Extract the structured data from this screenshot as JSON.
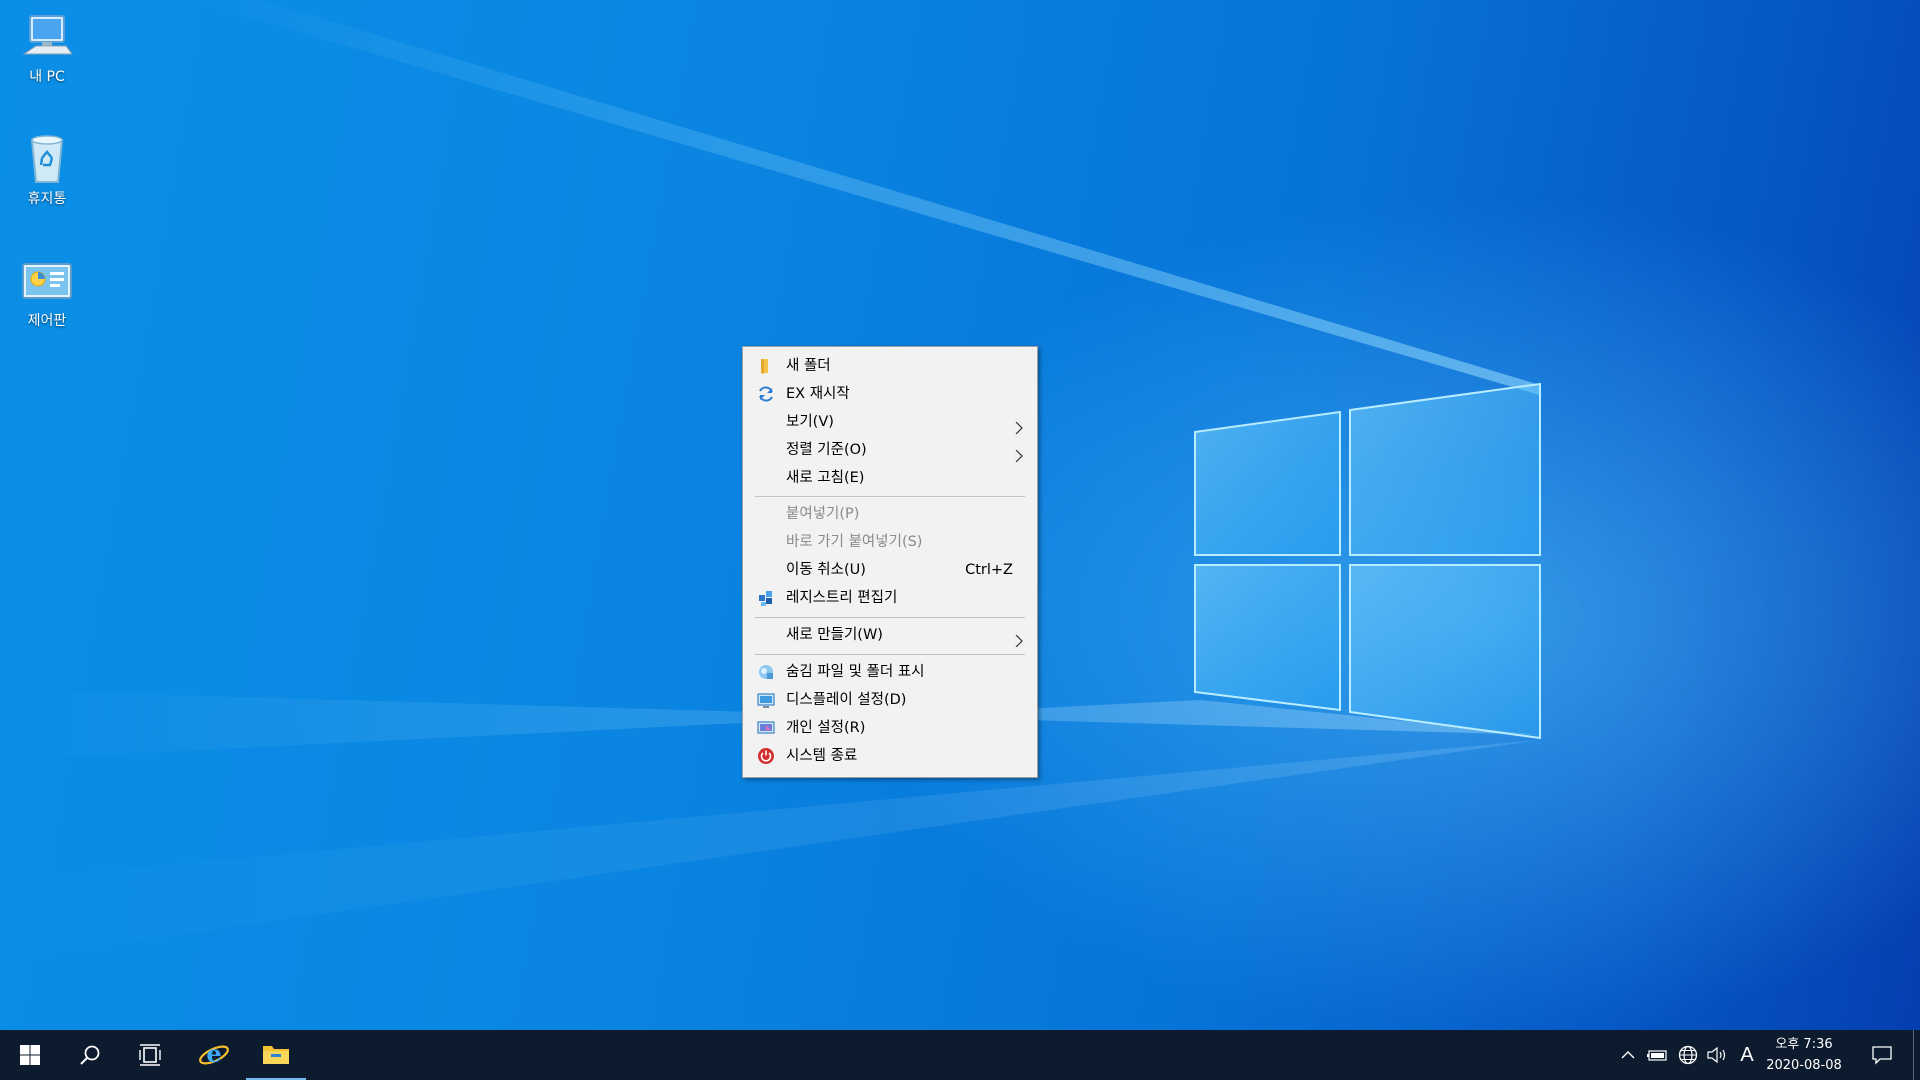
{
  "desktop_icons": [
    {
      "label": "내 PC",
      "icon": "computer-icon"
    },
    {
      "label": "휴지통",
      "icon": "recycle-bin-icon"
    },
    {
      "label": "제어판",
      "icon": "control-panel-icon"
    }
  ],
  "context_menu": {
    "items": [
      {
        "label": "새 폴더",
        "icon": "folder-icon",
        "enabled": true
      },
      {
        "label": "EX 재시작",
        "icon": "refresh-icon",
        "enabled": true
      },
      {
        "label": "보기(V)",
        "submenu": true,
        "enabled": true
      },
      {
        "label": "정렬 기준(O)",
        "submenu": true,
        "enabled": true
      },
      {
        "label": "새로 고침(E)",
        "enabled": true
      },
      {
        "label": "붙여넣기(P)",
        "enabled": false
      },
      {
        "label": "바로 가기 붙여넣기(S)",
        "enabled": false
      },
      {
        "label": "이동 취소(U)",
        "shortcut": "Ctrl+Z",
        "enabled": true
      },
      {
        "label": "레지스트리 편집기",
        "icon": "registry-icon",
        "enabled": true
      },
      {
        "label": "새로 만들기(W)",
        "submenu": true,
        "enabled": true
      },
      {
        "label": "숨김 파일 및 폴더 표시",
        "icon": "hidden-files-icon",
        "enabled": true
      },
      {
        "label": "디스플레이 설정(D)",
        "icon": "display-icon",
        "enabled": true
      },
      {
        "label": "개인 설정(R)",
        "icon": "personalize-icon",
        "enabled": true
      },
      {
        "label": "시스템 종료",
        "icon": "power-icon",
        "enabled": true
      }
    ]
  },
  "taskbar": {
    "buttons": [
      "start-icon",
      "search-icon",
      "task-view-icon",
      "internet-explorer-icon",
      "file-explorer-icon"
    ],
    "tray": [
      "chevron-up-icon",
      "battery-icon",
      "globe-icon",
      "volume-icon"
    ],
    "ime_indicator": "A",
    "clock": {
      "time": "오후 7:36",
      "date": "2020-08-08"
    }
  },
  "colors": {
    "desktop": "#0a86e2",
    "taskbar": "#0d1b2e",
    "menu_background": "#f2f2f2",
    "disabled_text": "#8a8a8a",
    "power_red": "#d32f2f"
  }
}
